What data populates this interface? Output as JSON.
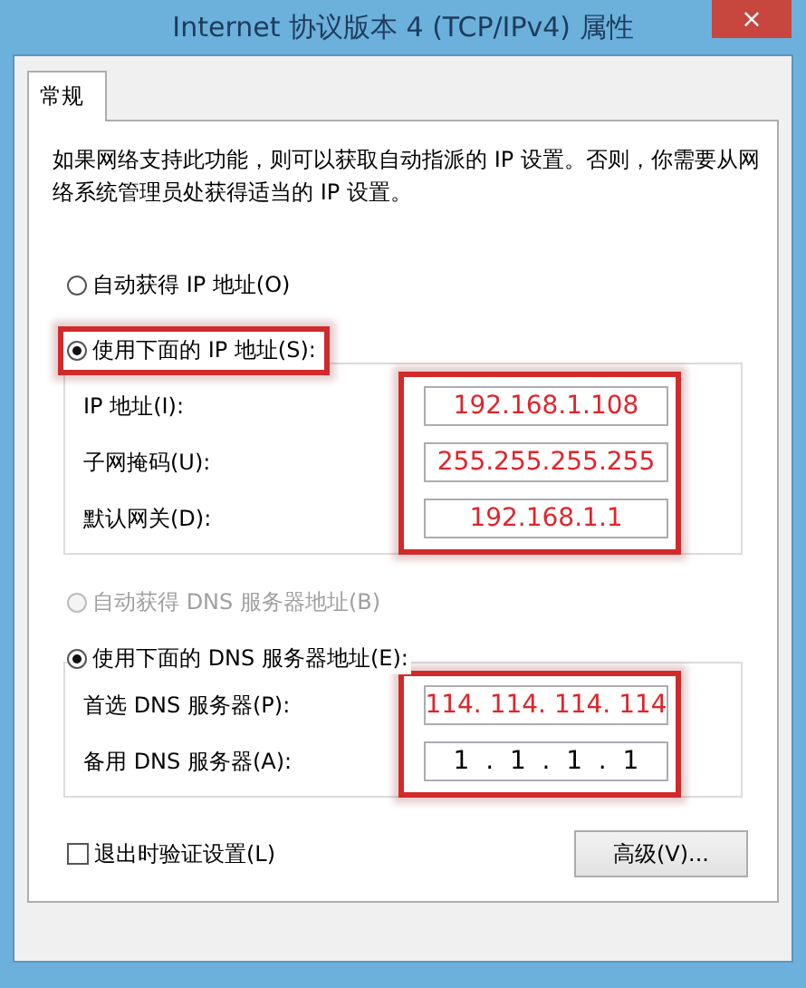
{
  "window": {
    "title": "Internet 协议版本 4 (TCP/IPv4) 属性",
    "close": "×"
  },
  "tabs": [
    {
      "label": "常规",
      "selected": true
    }
  ],
  "description": "如果网络支持此功能，则可以获取自动指派的 IP 设置。否则，你需要从网络系统管理员处获得适当的 IP 设置。",
  "ip_mode": [
    {
      "label": "自动获得 IP 地址(O)",
      "selected": false,
      "disabled": false,
      "highlighted": false
    },
    {
      "label": "使用下面的 IP 地址(S):",
      "selected": true,
      "disabled": false,
      "highlighted": true
    }
  ],
  "ip_fields": {
    "highlighted": true,
    "rows": [
      {
        "label": "IP 地址(I):",
        "value": "192.168.1.108",
        "emphasis": true
      },
      {
        "label": "子网掩码(U):",
        "value": "255.255.255.255",
        "emphasis": true
      },
      {
        "label": "默认网关(D):",
        "value": "192.168.1.1",
        "emphasis": true
      }
    ]
  },
  "dns_mode": [
    {
      "label": "自动获得 DNS 服务器地址(B)",
      "selected": false,
      "disabled": true,
      "highlighted": false
    },
    {
      "label": "使用下面的 DNS 服务器地址(E):",
      "selected": true,
      "disabled": false,
      "highlighted": false
    }
  ],
  "dns_fields": {
    "highlighted": true,
    "rows": [
      {
        "label": "首选 DNS 服务器(P):",
        "value": "114. 114. 114. 114",
        "emphasis": true
      },
      {
        "label": "备用 DNS 服务器(A):",
        "value": "1  .  1  .  1  .  1",
        "emphasis": false
      }
    ]
  },
  "validate_checkbox": {
    "label": "退出时验证设置(L)",
    "checked": false
  },
  "advanced_button": "高级(V)..."
}
